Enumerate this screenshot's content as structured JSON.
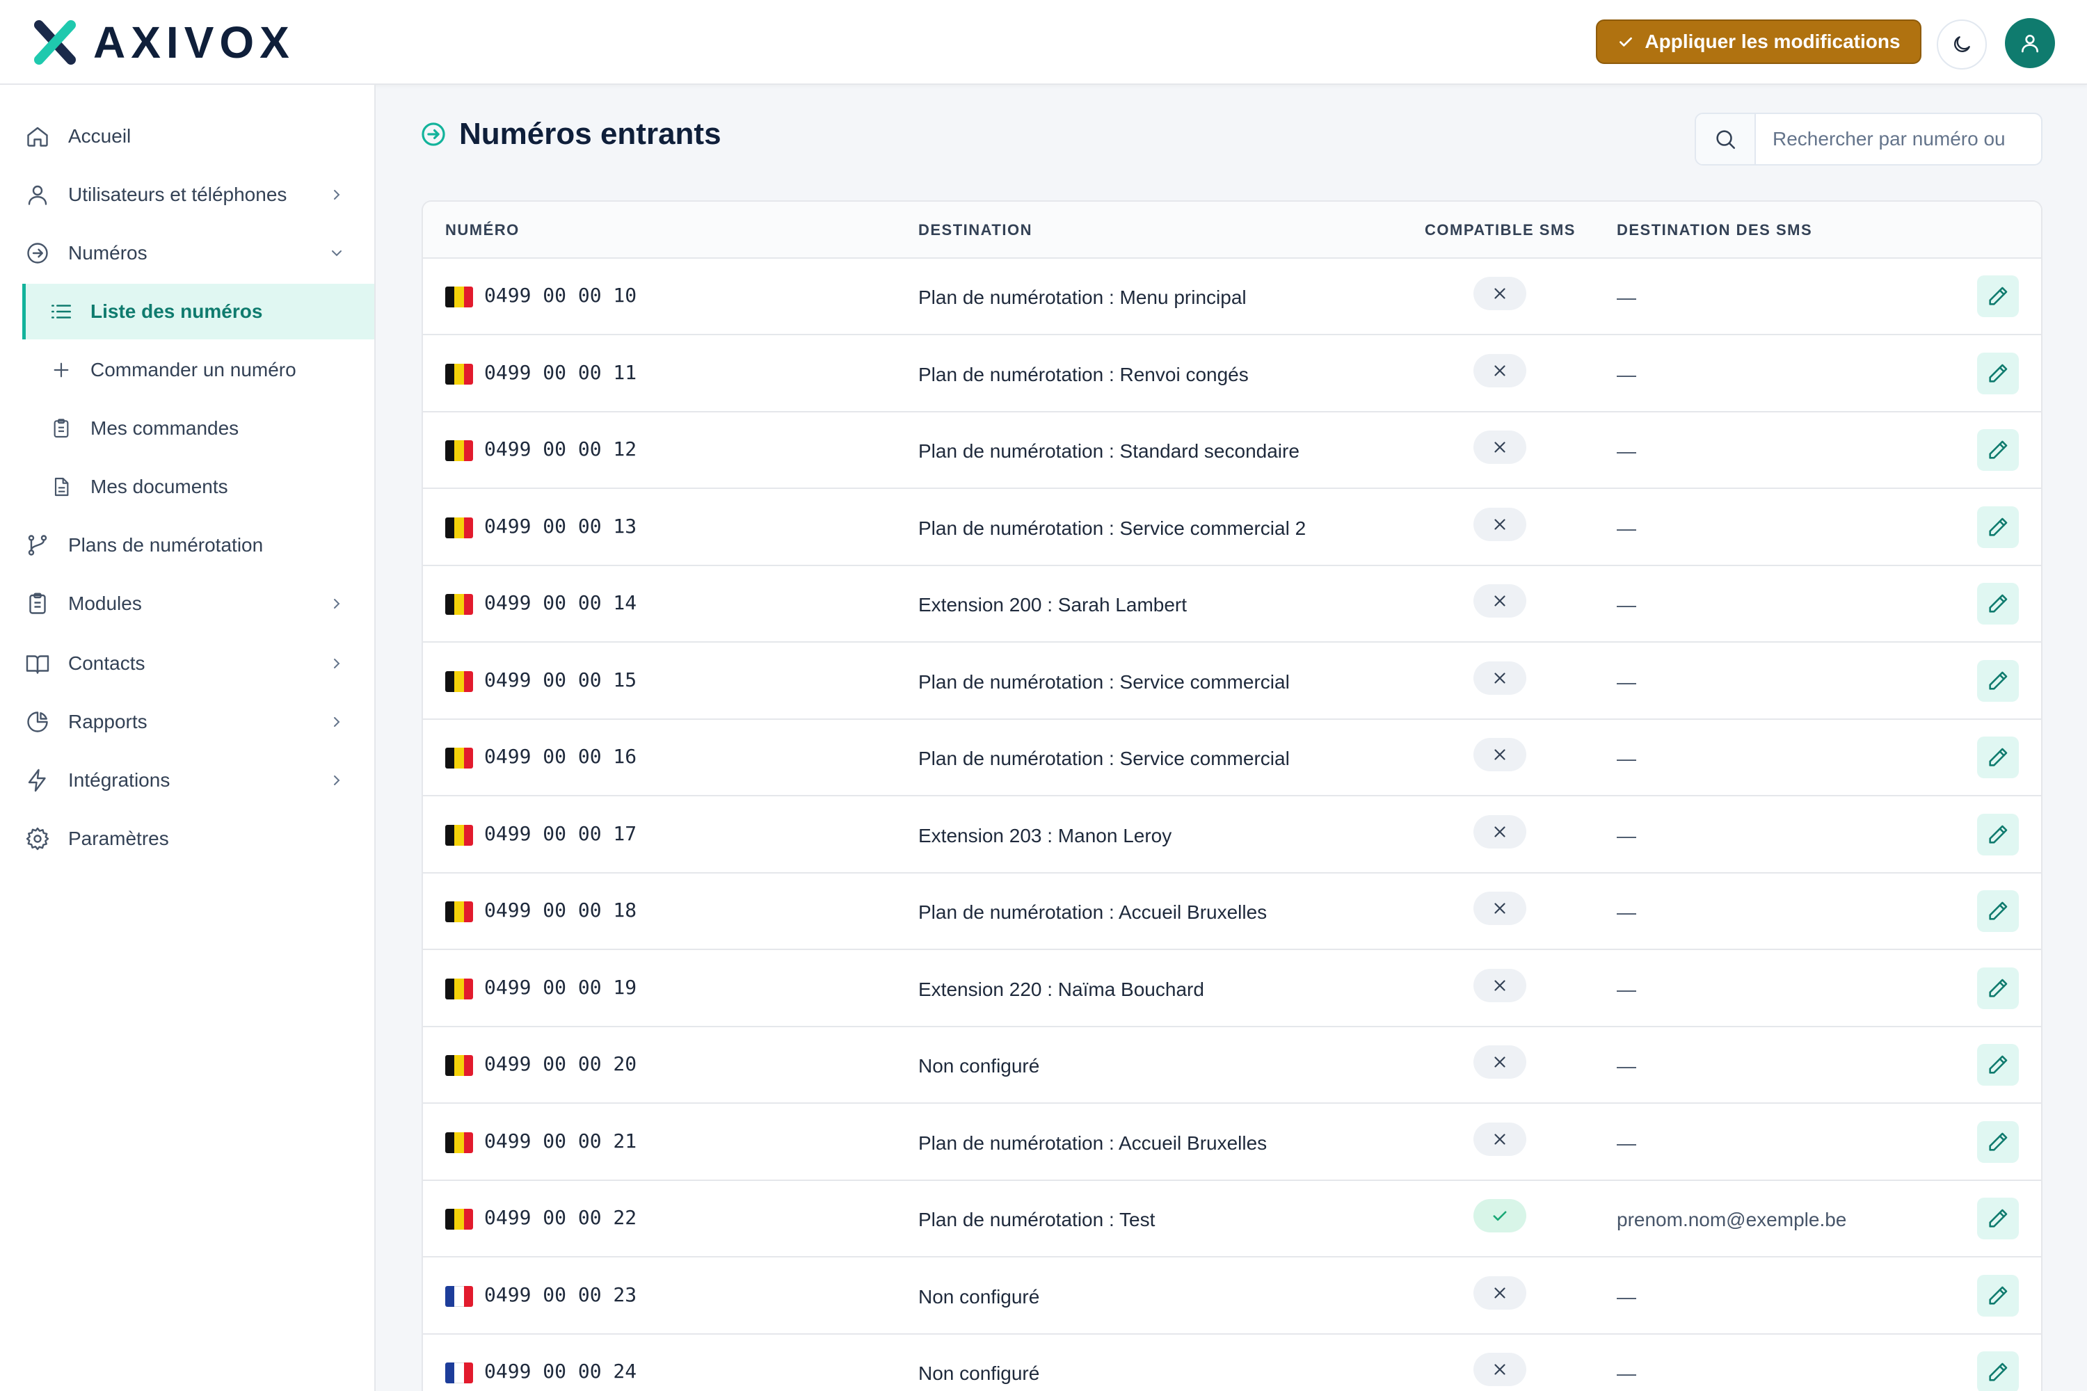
{
  "app": {
    "brand": "AXIVOX",
    "apply_label": "Appliquer les modifications",
    "colors": {
      "accent": "#12b39b",
      "apply_button": "#b07210",
      "avatar": "#0f7b6e",
      "active_bg": "#e0f7f2"
    }
  },
  "sidebar": {
    "items": [
      {
        "label": "Accueil",
        "icon": "home-icon"
      },
      {
        "label": "Utilisateurs et téléphones",
        "icon": "user-icon",
        "chevron": "right"
      },
      {
        "label": "Numéros",
        "icon": "arrow-circle-icon",
        "chevron": "down"
      },
      {
        "label": "Liste des numéros",
        "icon": "list-icon",
        "sub": true,
        "active": true
      },
      {
        "label": "Commander un numéro",
        "icon": "plus-icon",
        "sub": true
      },
      {
        "label": "Mes commandes",
        "icon": "clipboard-icon",
        "sub": true
      },
      {
        "label": "Mes documents",
        "icon": "document-icon",
        "sub": true
      },
      {
        "label": "Plans de numérotation",
        "icon": "branch-icon"
      },
      {
        "label": "Modules",
        "icon": "clipboard-icon",
        "chevron": "right"
      },
      {
        "label": "Contacts",
        "icon": "book-icon",
        "chevron": "right"
      },
      {
        "label": "Rapports",
        "icon": "pie-chart-icon",
        "chevron": "right"
      },
      {
        "label": "Intégrations",
        "icon": "bolt-icon",
        "chevron": "right"
      },
      {
        "label": "Paramètres",
        "icon": "gear-icon"
      }
    ]
  },
  "main": {
    "title": "Numéros entrants",
    "search_placeholder": "Rechercher par numéro ou",
    "columns": [
      "NUMÉRO",
      "DESTINATION",
      "COMPATIBLE SMS",
      "DESTINATION DES SMS"
    ],
    "rows": [
      {
        "country": "BE",
        "number": "0499 00 00 10",
        "destination": "Plan de numérotation : Menu principal",
        "sms": false,
        "sms_destination": "—"
      },
      {
        "country": "BE",
        "number": "0499 00 00 11",
        "destination": "Plan de numérotation : Renvoi congés",
        "sms": false,
        "sms_destination": "—"
      },
      {
        "country": "BE",
        "number": "0499 00 00 12",
        "destination": "Plan de numérotation : Standard secondaire",
        "sms": false,
        "sms_destination": "—"
      },
      {
        "country": "BE",
        "number": "0499 00 00 13",
        "destination": "Plan de numérotation : Service commercial 2",
        "sms": false,
        "sms_destination": "—"
      },
      {
        "country": "BE",
        "number": "0499 00 00 14",
        "destination": "Extension 200 : Sarah Lambert",
        "sms": false,
        "sms_destination": "—"
      },
      {
        "country": "BE",
        "number": "0499 00 00 15",
        "destination": "Plan de numérotation : Service commercial",
        "sms": false,
        "sms_destination": "—"
      },
      {
        "country": "BE",
        "number": "0499 00 00 16",
        "destination": "Plan de numérotation : Service commercial",
        "sms": false,
        "sms_destination": "—"
      },
      {
        "country": "BE",
        "number": "0499 00 00 17",
        "destination": "Extension 203 : Manon Leroy",
        "sms": false,
        "sms_destination": "—"
      },
      {
        "country": "BE",
        "number": "0499 00 00 18",
        "destination": "Plan de numérotation : Accueil Bruxelles",
        "sms": false,
        "sms_destination": "—"
      },
      {
        "country": "BE",
        "number": "0499 00 00 19",
        "destination": "Extension 220 : Naïma Bouchard",
        "sms": false,
        "sms_destination": "—"
      },
      {
        "country": "BE",
        "number": "0499 00 00 20",
        "destination": "Non configuré",
        "sms": false,
        "sms_destination": "—"
      },
      {
        "country": "BE",
        "number": "0499 00 00 21",
        "destination": "Plan de numérotation : Accueil Bruxelles",
        "sms": false,
        "sms_destination": "—"
      },
      {
        "country": "BE",
        "number": "0499 00 00 22",
        "destination": "Plan de numérotation : Test",
        "sms": true,
        "sms_destination": "prenom.nom@exemple.be"
      },
      {
        "country": "FR",
        "number": "0499 00 00 23",
        "destination": "Non configuré",
        "sms": false,
        "sms_destination": "—"
      },
      {
        "country": "FR",
        "number": "0499 00 00 24",
        "destination": "Non configuré",
        "sms": false,
        "sms_destination": "—"
      }
    ]
  }
}
